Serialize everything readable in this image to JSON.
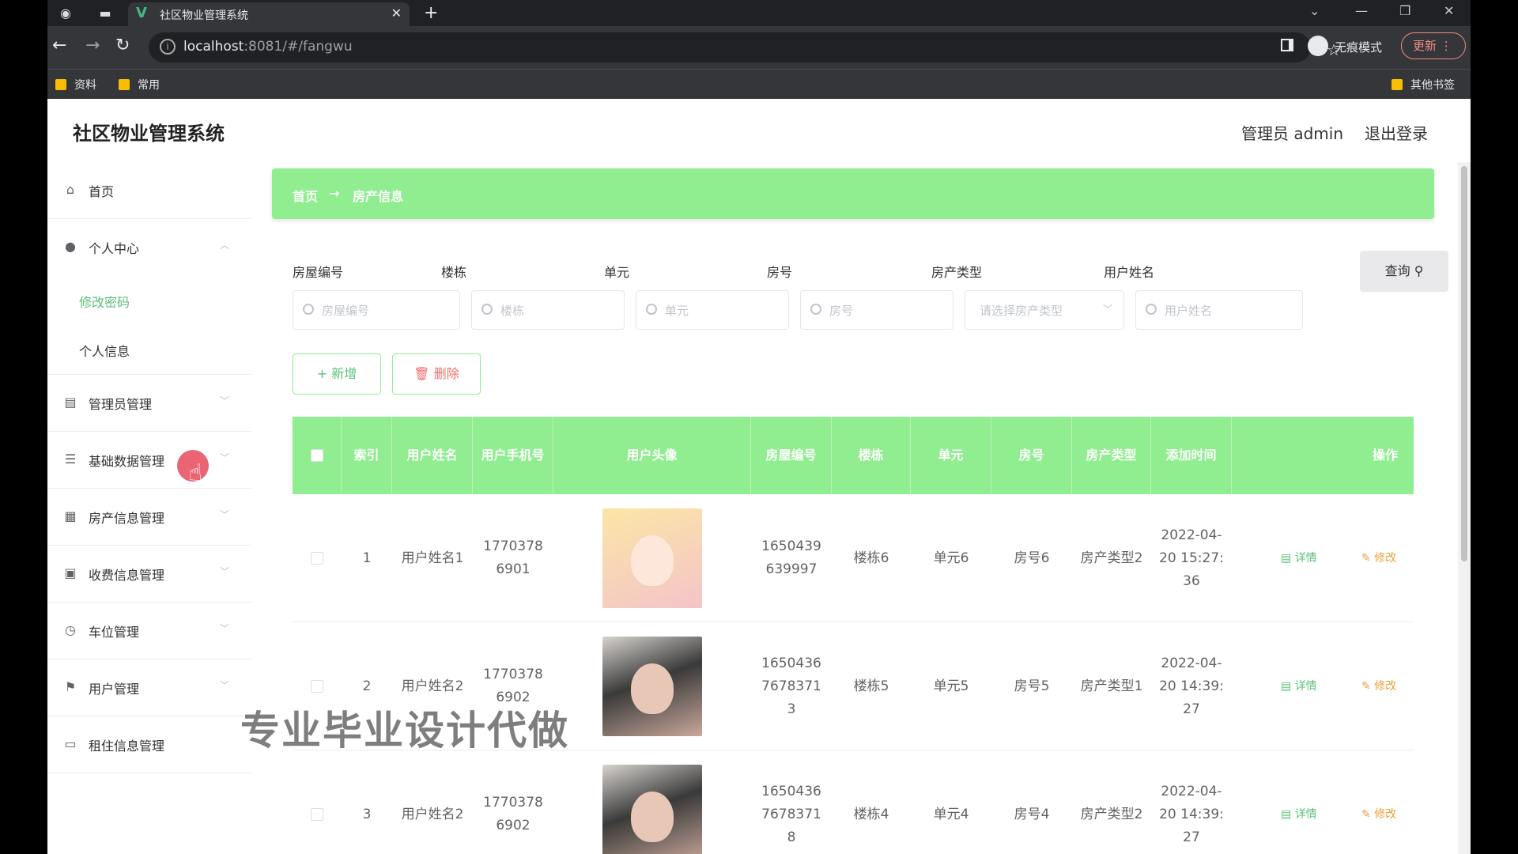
{
  "browser": {
    "tab_title": "社区物业管理系统",
    "url_host": "localhost",
    "url_rest": ":8081/#/fangwu",
    "incognito_label": "无痕模式",
    "update_label": "更新",
    "bookmarks": [
      "资料",
      "常用"
    ],
    "other_bookmarks": "其他书签"
  },
  "app": {
    "title": "社区物业管理系统",
    "admin_label": "管理员 admin",
    "logout_label": "退出登录"
  },
  "sidebar": {
    "home": "首页",
    "personal": "个人中心",
    "personal_sub": [
      "修改密码",
      "个人信息"
    ],
    "items": [
      "管理员管理",
      "基础数据管理",
      "房产信息管理",
      "收费信息管理",
      "车位管理",
      "用户管理",
      "租住信息管理"
    ]
  },
  "breadcrumb": {
    "home": "首页",
    "arrow": "→",
    "page": "房产信息"
  },
  "filters": [
    {
      "label": "房屋编号",
      "placeholder": "房屋编号"
    },
    {
      "label": "楼栋",
      "placeholder": "楼栋"
    },
    {
      "label": "单元",
      "placeholder": "单元"
    },
    {
      "label": "房号",
      "placeholder": "房号"
    },
    {
      "label": "房产类型",
      "placeholder": "请选择房产类型"
    },
    {
      "label": "用户姓名",
      "placeholder": "用户姓名"
    }
  ],
  "buttons": {
    "query": "查询",
    "add": "+ 新增",
    "delete": "删除"
  },
  "table": {
    "headers": [
      "索引",
      "用户姓名",
      "用户手机号",
      "用户头像",
      "房屋编号",
      "楼栋",
      "单元",
      "房号",
      "房产类型",
      "添加时间",
      "操作"
    ],
    "rows": [
      {
        "index": "1",
        "name": "用户姓名1",
        "phone": "17703786901",
        "avatar": "anime",
        "house_no": "1650439639997",
        "building": "楼栋6",
        "unit": "单元6",
        "room": "房号6",
        "type": "房产类型2",
        "time": "2022-04-20 15:27:36"
      },
      {
        "index": "2",
        "name": "用户姓名2",
        "phone": "17703786902",
        "avatar": "real",
        "house_no": "16504367678371 3",
        "building": "楼栋5",
        "unit": "单元5",
        "room": "房号5",
        "type": "房产类型1",
        "time": "2022-04-20 14:39:27"
      },
      {
        "index": "3",
        "name": "用户姓名2",
        "phone": "17703786902",
        "avatar": "real",
        "house_no": "16504367678371 8",
        "building": "楼栋4",
        "unit": "单元4",
        "room": "房号4",
        "type": "房产类型2",
        "time": "2022-04-20 14:39:27"
      }
    ],
    "detail_label": "详情",
    "edit_label": "修改"
  },
  "watermark": "专业毕业设计代做"
}
